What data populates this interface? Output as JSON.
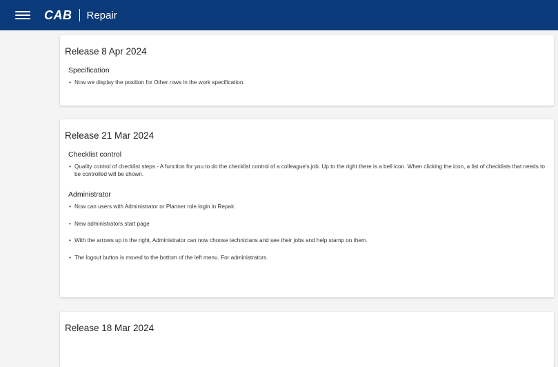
{
  "header": {
    "logo_text": "CAB",
    "app_name": "Repair",
    "menu_icon": "hamburger-menu-icon"
  },
  "releases": [
    {
      "title": "Release 8 Apr 2024",
      "sections": [
        {
          "title": "Specification",
          "items": [
            "Now we display the position for Other rows in the work specification."
          ]
        }
      ]
    },
    {
      "title": "Release 21 Mar 2024",
      "sections": [
        {
          "title": "Checklist control",
          "items": [
            "Quality control of checklist steps - A function for you to do the checklist control of a colleague's job. Up to the right there is a bell icon. When clicking the icon, a list of checklists that needs to be controlled will be shown."
          ]
        },
        {
          "title": "Administrator",
          "items": [
            "Now can users with Administrator or Planner role login in Repair.",
            "New administrators start page",
            "With the arrows up in the right, Administrator can now choose technicians and see their jobs and help stamp on them.",
            "The logout button is moved to the bottom of the left menu. For administrators."
          ]
        }
      ]
    },
    {
      "title": "Release 18 Mar 2024",
      "sections": []
    }
  ]
}
